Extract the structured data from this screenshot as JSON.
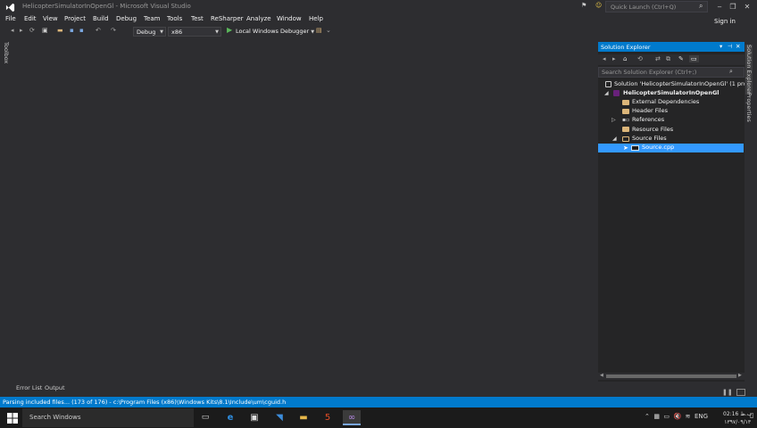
{
  "window": {
    "title": "HelicopterSimulatorInOpenGl - Microsoft Visual Studio",
    "quick_launch_placeholder": "Quick Launch (Ctrl+Q)",
    "sign_in": "Sign in"
  },
  "menu": {
    "items": [
      "File",
      "Edit",
      "View",
      "Project",
      "Build",
      "Debug",
      "Team",
      "Tools",
      "Test",
      "ReSharper",
      "Analyze",
      "Window",
      "Help"
    ]
  },
  "toolbar": {
    "configuration": "Debug",
    "platform": "x86",
    "run_label": "Local Windows Debugger"
  },
  "toolbox": {
    "label": "Toolbox"
  },
  "solution_explorer": {
    "title": "Solution Explorer",
    "search_placeholder": "Search Solution Explorer (Ctrl+;)",
    "solution_label": "Solution 'HelicopterSimulatorInOpenGl' (1 project)",
    "project_label": "HelicopterSimulatorInOpenGl",
    "external_dependencies": "External Dependencies",
    "header_files": "Header Files",
    "references": "References",
    "resource_files": "Resource Files",
    "source_files": "Source Files",
    "source_cpp": "Source.cpp",
    "side_tabs": [
      "Solution Explorer",
      "Properties"
    ]
  },
  "bottom_tabs": {
    "error_list": "Error List",
    "output": "Output"
  },
  "status": {
    "text": "Parsing included files... (173 of 176) - c:\\Program Files (x86)\\Windows Kits\\8.1\\Include\\um\\cguid.h"
  },
  "taskbar": {
    "search_placeholder": "Search Windows",
    "language": "ENG",
    "time": "02:16 ب.ظ",
    "date": "۱۳۹۷/۰۹/۱۳"
  },
  "colors": {
    "accent": "#007acc",
    "background": "#2d2d30",
    "panel": "#252526",
    "selection": "#3399ff"
  }
}
